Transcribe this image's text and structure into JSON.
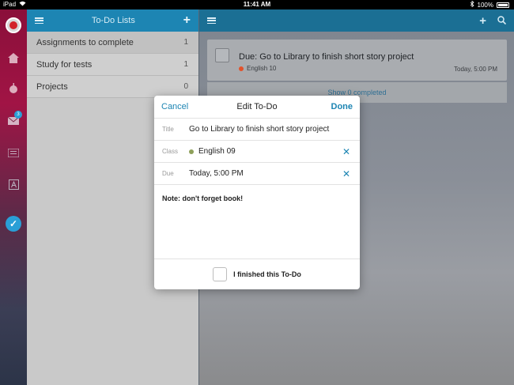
{
  "status_bar": {
    "device": "iPad",
    "time": "11:41 AM",
    "battery": "100%"
  },
  "rail": {
    "icons": [
      "logo-icon",
      "home-icon",
      "apple-icon",
      "mail-icon",
      "list-icon",
      "text-icon",
      "check-icon"
    ],
    "mail_badge": "3"
  },
  "lists_panel": {
    "title": "To-Do Lists",
    "items": [
      {
        "label": "Assignments to complete",
        "count": "1"
      },
      {
        "label": "Study for tests",
        "count": "1"
      },
      {
        "label": "Projects",
        "count": "0"
      }
    ]
  },
  "main": {
    "todo": {
      "title": "Due: Go to Library to finish short story project",
      "class": "English 10",
      "class_color": "#e2522b",
      "time": "Today, 5:00 PM"
    },
    "show_completed": "Show 0 completed"
  },
  "modal": {
    "cancel_label": "Cancel",
    "title": "Edit To-Do",
    "done_label": "Done",
    "fields": {
      "title_label": "Title",
      "title_value": "Go to Library to finish short story project",
      "class_label": "Class",
      "class_value": "English 09",
      "class_color": "#8ea05a",
      "due_label": "Due",
      "due_value": "Today, 5:00 PM"
    },
    "notes": "Note: don't forget book!",
    "finish_label": "I finished this To-Do"
  },
  "colors": {
    "accent": "#1d85b3"
  }
}
